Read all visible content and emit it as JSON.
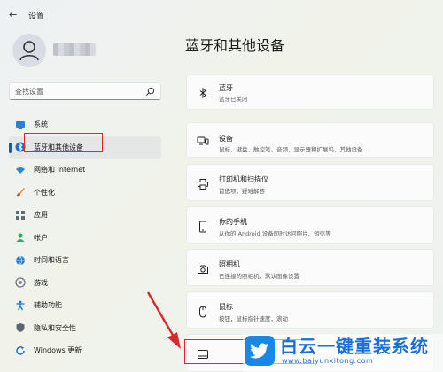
{
  "window": {
    "back_glyph": "←",
    "title": "设置"
  },
  "search": {
    "placeholder": "查找设置"
  },
  "nav": [
    {
      "label": "系统",
      "icon": "monitor-icon"
    },
    {
      "label": "蓝牙和其他设备",
      "icon": "bluetooth-icon",
      "selected": true
    },
    {
      "label": "网络和 Internet",
      "icon": "wifi-icon"
    },
    {
      "label": "个性化",
      "icon": "brush-icon"
    },
    {
      "label": "应用",
      "icon": "apps-icon"
    },
    {
      "label": "帐户",
      "icon": "person-icon"
    },
    {
      "label": "时间和语言",
      "icon": "globe-icon"
    },
    {
      "label": "游戏",
      "icon": "gamepad-icon"
    },
    {
      "label": "辅助功能",
      "icon": "accessibility-icon"
    },
    {
      "label": "隐私和安全性",
      "icon": "shield-icon"
    },
    {
      "label": "Windows 更新",
      "icon": "update-icon"
    }
  ],
  "main": {
    "title": "蓝牙和其他设备",
    "cards": [
      {
        "title": "蓝牙",
        "subtitle": "蓝牙已关闭",
        "icon": "bluetooth-icon"
      },
      {
        "title": "设备",
        "subtitle": "鼠标、键盘、触控笔、音频、显示器和扩展坞、其他设备",
        "icon": "devices-icon"
      },
      {
        "title": "打印机和扫描仪",
        "subtitle": "首选项，疑难解答",
        "icon": "printer-icon"
      },
      {
        "title": "你的手机",
        "subtitle": "从你的 Android 设备即时访问照片、短信等",
        "icon": "phone-icon"
      },
      {
        "title": "照相机",
        "subtitle": "已连接的照相机，默认图像设置",
        "icon": "camera-icon"
      },
      {
        "title": "鼠标",
        "subtitle": "按钮，鼠标指针速度，滚动",
        "icon": "mouse-icon"
      },
      {
        "title": "触摸板",
        "subtitle": "",
        "icon": "touchpad-icon"
      }
    ]
  },
  "watermark": {
    "title": "白云一键重装系统",
    "url": "www.baiyunxitong.com"
  },
  "colors": {
    "accent": "#0067c0",
    "annotation_red": "#d9282e",
    "watermark_blue": "#1b6fd8"
  }
}
